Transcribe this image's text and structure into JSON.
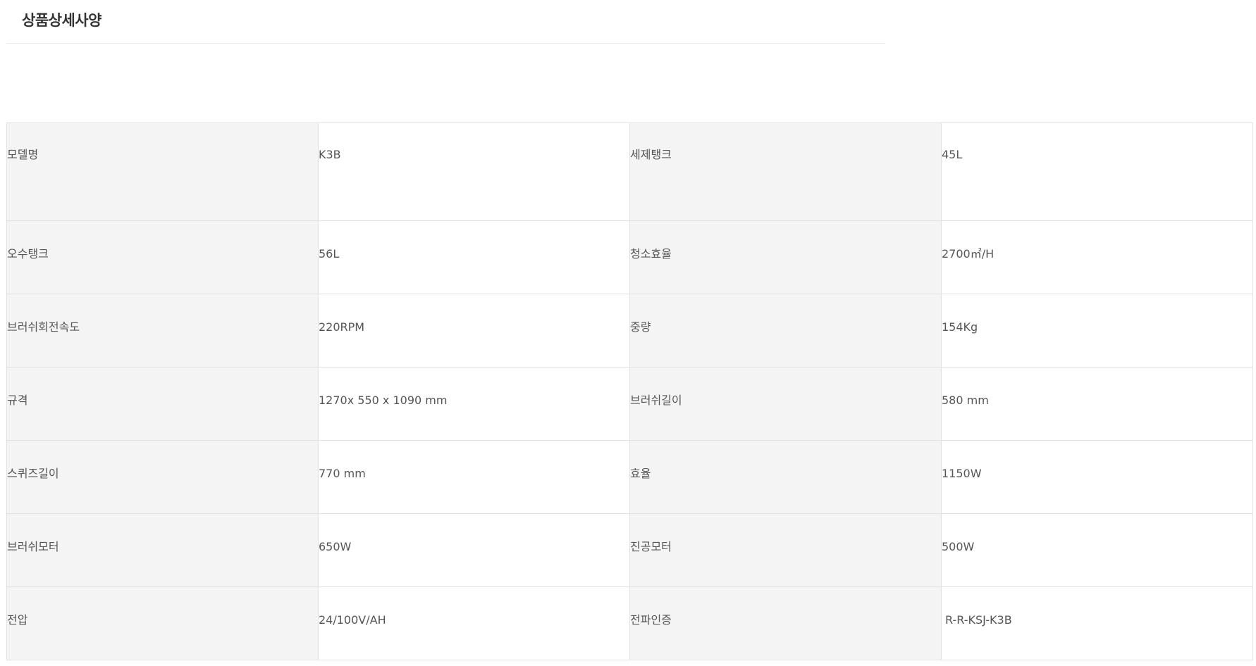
{
  "header": {
    "title": "상품상세사양"
  },
  "specs": {
    "rows": [
      {
        "label1": "모델명",
        "value1": "K3B",
        "label2": "세제탱크",
        "value2": "45L"
      },
      {
        "label1": "오수탱크",
        "value1": "56L",
        "label2": "청소효율",
        "value2": "2700㎡/H"
      },
      {
        "label1": "브러쉬회전속도",
        "value1": "220RPM",
        "label2": "중량",
        "value2": "154Kg"
      },
      {
        "label1": "규격",
        "value1": "1270x 550 x 1090 mm",
        "label2": "브러쉬길이",
        "value2": "580 mm"
      },
      {
        "label1": "스퀴즈길이",
        "value1": "770 mm",
        "label2": "효율",
        "value2": "1150W"
      },
      {
        "label1": "브러쉬모터",
        "value1": "650W",
        "label2": "진공모터",
        "value2": "500W"
      },
      {
        "label1": "전압",
        "value1": "24/100V/AH",
        "label2": "전파인증",
        "value2": "R-R-KSJ-K3B"
      }
    ]
  },
  "colors": {
    "label_bg": "#f4f4f4",
    "border": "#e2e2e2",
    "text": "#555555",
    "title": "#333333"
  }
}
